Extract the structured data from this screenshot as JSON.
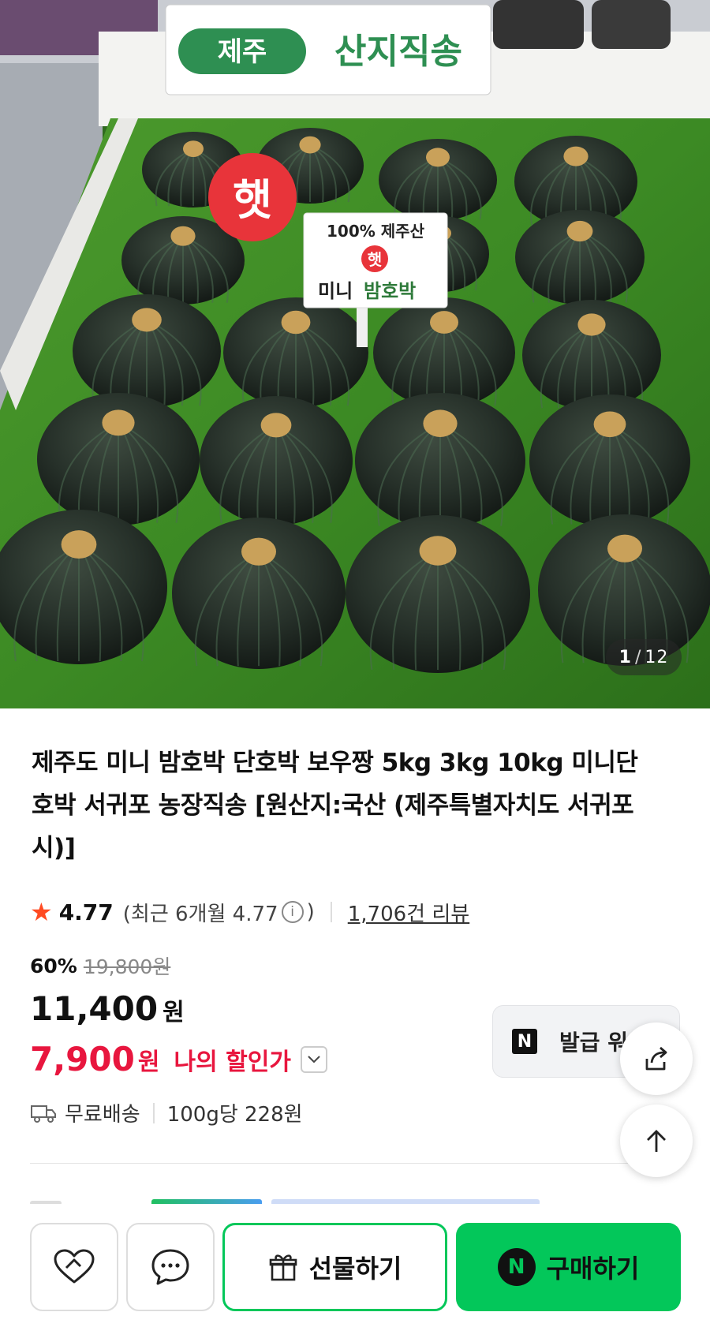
{
  "gallery": {
    "sign_region": "제주",
    "sign_main": "산지직송",
    "badge": "햇",
    "card_line1": "100% 제주산",
    "card_badge": "햇",
    "card_line2a": "미니",
    "card_line2b": "밤호박",
    "current": "1",
    "separator": "/",
    "total": "12"
  },
  "product": {
    "title": "제주도 미니 밤호박 단호박 보우짱 5kg 3kg 10kg 미니단호박 서귀포 농장직송 [원산지:국산 (제주특별자치도 서귀포시)]",
    "rating": "4.77",
    "recent_open": "(최근 6개월 4.77",
    "recent_close": ")",
    "info_glyph": "i",
    "reviews": "1,706건 리뷰",
    "discount_rate": "60%",
    "original_price": "19,800원",
    "price": "11,400",
    "price_unit": "원",
    "my_price": "7,900",
    "my_price_unit": "원",
    "my_price_label": "나의 할인가",
    "coupon_badge": "N",
    "coupon_label": "발급 워",
    "shipping": "무료배송",
    "unit_price": "100g당 228원"
  },
  "bottom_bar": {
    "gift_label": "선물하기",
    "buy_badge": "N",
    "buy_label": "구매하기"
  },
  "colors": {
    "brand_green": "#03c75a",
    "discount_red": "#e8163e",
    "star": "#ff4b22"
  },
  "icons": [
    "heart-icon",
    "chat-icon",
    "gift-icon",
    "share-icon",
    "arrow-up-icon",
    "truck-icon",
    "chevron-down-icon",
    "star-icon",
    "info-icon"
  ]
}
